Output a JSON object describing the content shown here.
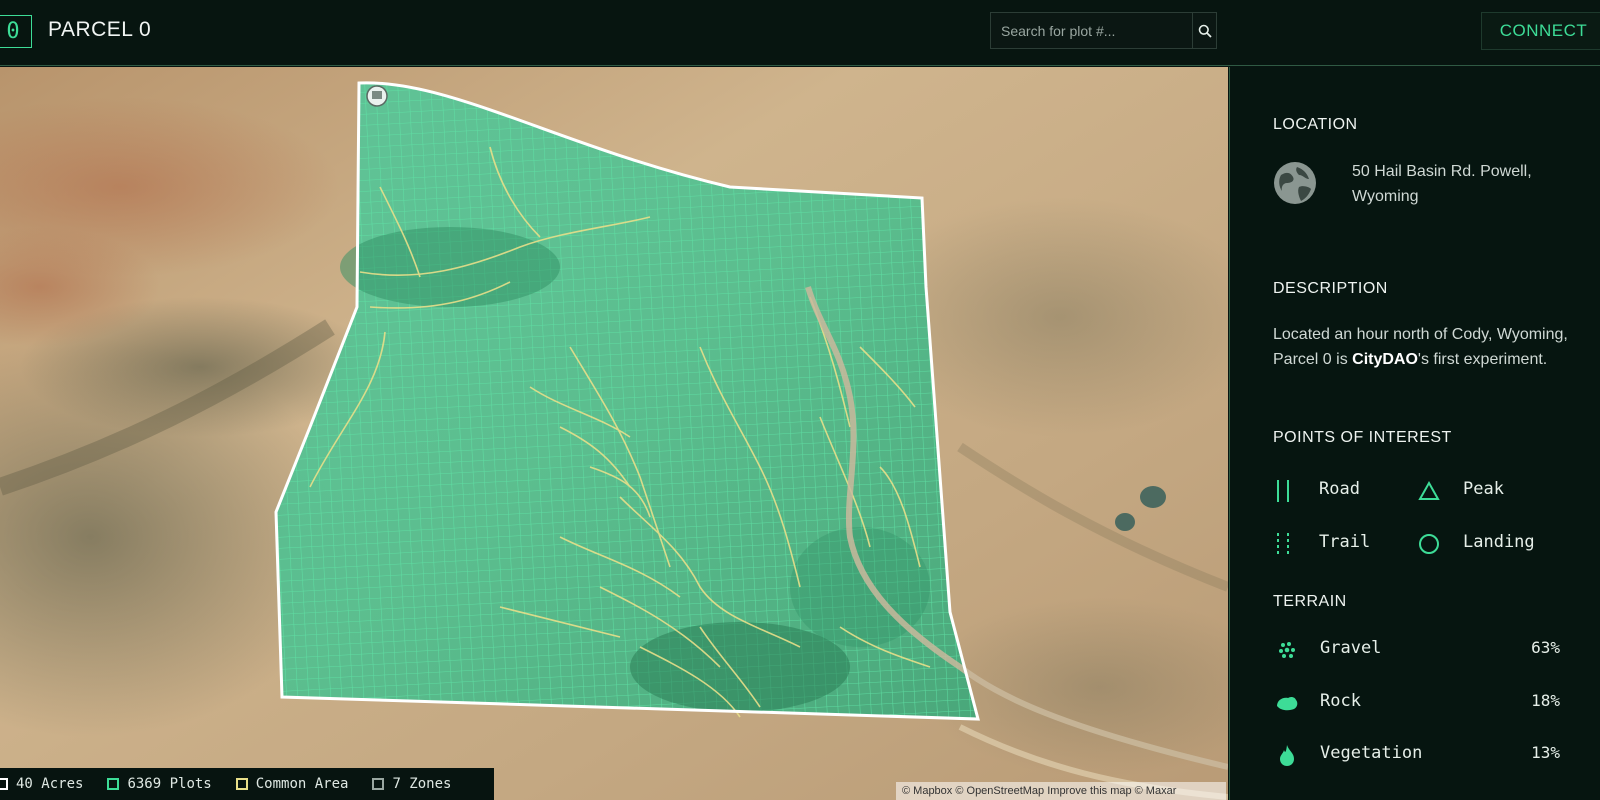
{
  "header": {
    "logo_text": "0",
    "title": "PARCEL 0",
    "search_placeholder": "Search for plot #...",
    "connect_label": "CONNECT",
    "accent_color": "#3ddc97"
  },
  "sidebar": {
    "location": {
      "title": "LOCATION",
      "address": "50 Hail Basin Rd. Powell, Wyoming",
      "icon": "globe-icon"
    },
    "description": {
      "title": "DESCRIPTION",
      "text_before": "Located an hour north of Cody, Wyoming, Parcel 0 is ",
      "highlight": "CityDAO",
      "text_after": "'s first experiment."
    },
    "poi": {
      "title": "POINTS OF INTEREST",
      "items": [
        {
          "label": "Road",
          "icon": "road-icon"
        },
        {
          "label": "Peak",
          "icon": "triangle-icon"
        },
        {
          "label": "Trail",
          "icon": "trail-icon"
        },
        {
          "label": "Landing",
          "icon": "circle-icon"
        }
      ]
    },
    "terrain": {
      "title": "TERRAIN",
      "items": [
        {
          "label": "Gravel",
          "percent": "63%",
          "icon": "gravel-icon"
        },
        {
          "label": "Rock",
          "percent": "18%",
          "icon": "rock-icon"
        },
        {
          "label": "Vegetation",
          "percent": "13%",
          "icon": "vegetation-icon"
        }
      ]
    }
  },
  "legend": {
    "items": [
      {
        "label": "40 Acres",
        "color": "#ffffff"
      },
      {
        "label": "6369 Plots",
        "color": "#3ddc97"
      },
      {
        "label": "Common Area",
        "color": "#e8df8a"
      },
      {
        "label": "7 Zones",
        "color": "#9aa7a1"
      }
    ]
  },
  "map": {
    "attribution": "© Mapbox © OpenStreetMap Improve this map © Maxar"
  }
}
